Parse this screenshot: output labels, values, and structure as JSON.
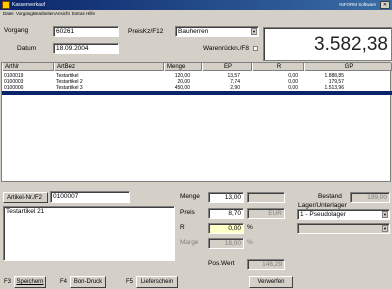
{
  "window": {
    "title": "Kassenverkauf",
    "brand": "INFORM Software"
  },
  "menu": [
    "Datei",
    "Vorgang",
    "Bearbeiten",
    "Ansicht",
    "Extras",
    "Hilfe"
  ],
  "header": {
    "vorgang_label": "Vorgang",
    "vorgang_value": "60261",
    "datum_label": "Datum",
    "datum_value": "18.09.2004",
    "preiskz_label": "PreisKz/F12",
    "preiskz_value": "Bauherren",
    "warenruck_label": "Warenrückn./F8",
    "total": "3.582,38"
  },
  "grid": {
    "columns": [
      "ArtNr",
      "ArtBez",
      "Menge",
      "EP",
      "R",
      "GP"
    ],
    "rows": [
      {
        "artnr": "0100019",
        "artbez": "Testartikel",
        "menge": "120,00",
        "ep": "13,57",
        "r": "0,00",
        "gp": "1.888,85"
      },
      {
        "artnr": "0100003",
        "artbez": "Testartikel 2",
        "menge": "20,00",
        "ep": "7,74",
        "r": "0,00",
        "gp": "179,57"
      },
      {
        "artnr": "0100000",
        "artbez": "Testartikel 3",
        "menge": "450,00",
        "ep": "2,90",
        "r": "0,00",
        "gp": "1.513,96"
      }
    ]
  },
  "detail": {
    "artikelnr_label": "Artikel-Nr./F2",
    "artikelnr_value": "0100007",
    "description": "Testartikel 21",
    "menge_label": "Menge",
    "menge_value": "13,00",
    "preis_label": "Preis",
    "preis_value": "8,70",
    "currency": "EUR",
    "r_label": "R",
    "r_value": "0,00",
    "percent": "%",
    "marge_label": "Marge",
    "marge_value": "18,00",
    "poswert_label": "Pos.Wert",
    "poswert_value": "146,29",
    "bestand_label": "Bestand",
    "bestand_value": "199,00",
    "lager_label": "Lager/Unterlager",
    "lager_value": "1 - Pseudolager"
  },
  "footer": {
    "f3_key": "F3",
    "f3_label": "Speichern",
    "f4_key": "F4",
    "f4_label": "Bon-Druck",
    "f5_key": "F5",
    "f5_label": "Lieferschein",
    "verwerfen_label": "Verwerfen"
  }
}
